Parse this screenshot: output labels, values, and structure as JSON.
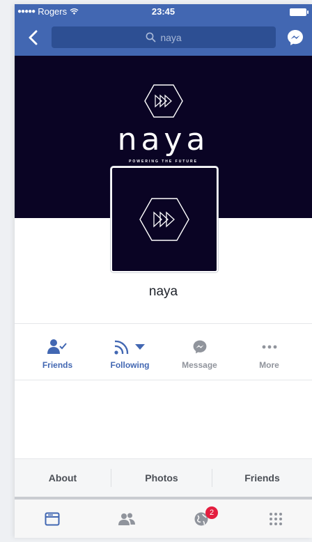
{
  "status_bar": {
    "carrier": "Rogers",
    "time": "23:45"
  },
  "nav": {
    "search_text": "naya"
  },
  "cover": {
    "wordmark": "naya",
    "tagline": "POWERING THE FUTURE"
  },
  "profile": {
    "name": "naya"
  },
  "actions": [
    {
      "label": "Friends",
      "icon": "friend-check-icon"
    },
    {
      "label": "Following",
      "icon": "rss-dropdown-icon"
    },
    {
      "label": "Message",
      "icon": "messenger-icon"
    },
    {
      "label": "More",
      "icon": "more-dots-icon"
    }
  ],
  "sub_tabs": [
    "About",
    "Photos",
    "Friends"
  ],
  "tab_bar": {
    "items": [
      "news-feed-icon",
      "friends-icon",
      "globe-notifications-icon",
      "menu-grid-icon"
    ],
    "notifications_badge": "2"
  },
  "colors": {
    "brand": "#4267b2",
    "cover": "#0a0424",
    "badge": "#e41e3f"
  }
}
